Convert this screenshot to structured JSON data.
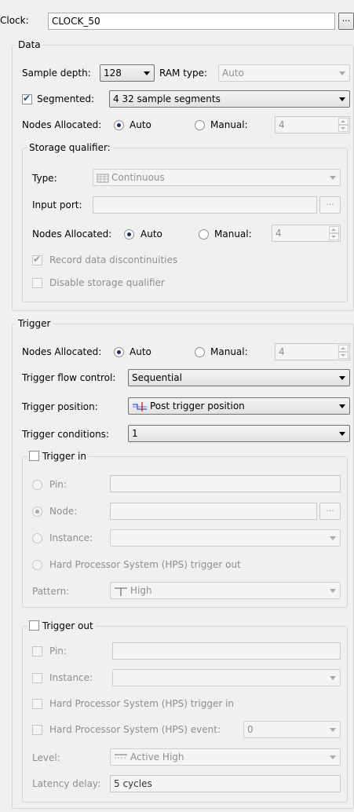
{
  "clock": {
    "label": "Clock:",
    "value": "CLOCK_50",
    "browse": "..."
  },
  "data": {
    "title": "Data",
    "sample_depth_label": "Sample depth:",
    "sample_depth_value": "128",
    "ram_type_label": "RAM type:",
    "ram_type_value": "Auto",
    "segmented_label": "Segmented:",
    "segmented_checked": true,
    "segmented_value": "4  32 sample segments",
    "nodes_label": "Nodes Allocated:",
    "auto_label": "Auto",
    "manual_label": "Manual:",
    "nodes_value": "4",
    "storage": {
      "title": "Storage qualifier:",
      "type_label": "Type:",
      "type_value": "Continuous",
      "type_icon": "continuous-icon",
      "input_port_label": "Input port:",
      "input_port_value": "",
      "browse": "...",
      "nodes_label": "Nodes Allocated:",
      "auto_label": "Auto",
      "manual_label": "Manual:",
      "nodes_value": "4",
      "record_label": "Record data discontinuities",
      "disable_label": "Disable storage qualifier"
    }
  },
  "trigger": {
    "title": "Trigger",
    "nodes_label": "Nodes Allocated:",
    "auto_label": "Auto",
    "manual_label": "Manual:",
    "nodes_value": "4",
    "flow_label": "Trigger flow control:",
    "flow_value": "Sequential",
    "position_label": "Trigger position:",
    "position_value": "Post trigger position",
    "position_icon": "post-trigger-icon",
    "conditions_label": "Trigger conditions:",
    "conditions_value": "1",
    "trigger_in": {
      "title": "Trigger in",
      "pin_label": "Pin:",
      "node_label": "Node:",
      "instance_label": "Instance:",
      "hps_label": "Hard Processor System (HPS) trigger out",
      "pattern_label": "Pattern:",
      "pattern_value": "High",
      "pattern_icon": "high-level-icon",
      "browse": "..."
    },
    "trigger_out": {
      "title": "Trigger out",
      "pin_label": "Pin:",
      "instance_label": "Instance:",
      "hps_in_label": "Hard Processor System (HPS) trigger in",
      "hps_event_label": "Hard Processor System (HPS) event:",
      "hps_event_value": "0",
      "level_label": "Level:",
      "level_value": "Active High",
      "level_icon": "active-high-icon",
      "latency_label": "Latency delay:",
      "latency_value": "5 cycles"
    }
  }
}
